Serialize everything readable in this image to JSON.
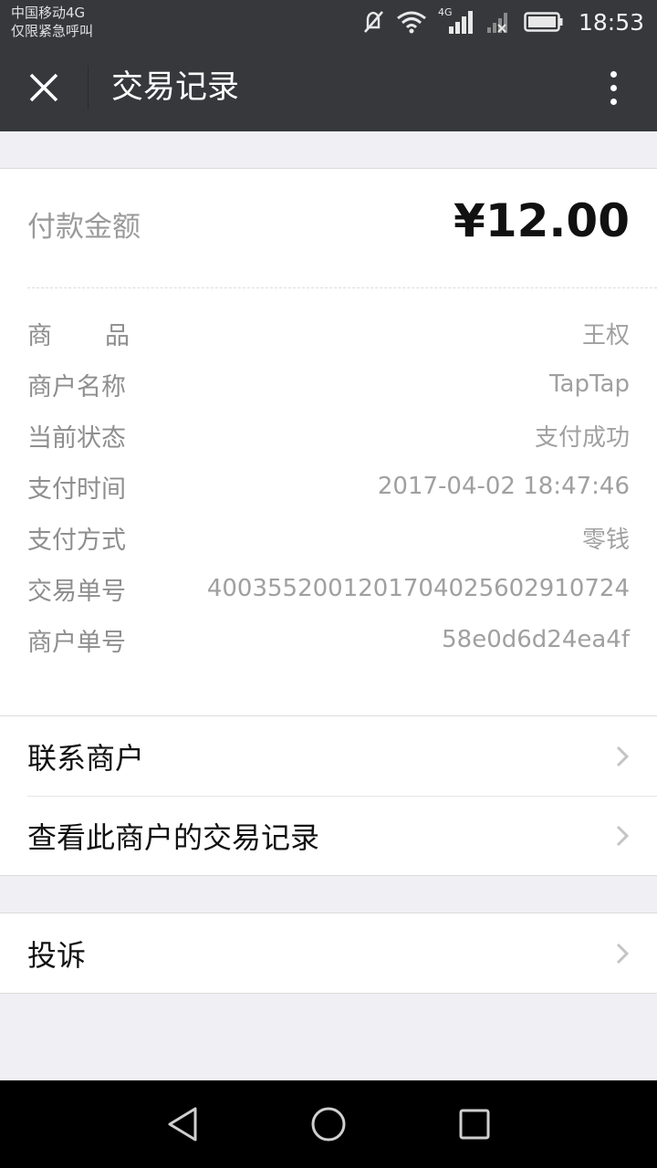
{
  "status_bar": {
    "carrier_line1": "中国移动4G",
    "carrier_line2": "仅限紧急呼叫",
    "network_label": "4G",
    "time": "18:53",
    "icons": [
      "mute-icon",
      "wifi-icon",
      "signal-icon",
      "no-signal-icon",
      "battery-icon"
    ]
  },
  "header": {
    "title": "交易记录",
    "close_icon": "close-icon",
    "more_icon": "more-vertical-icon"
  },
  "payment": {
    "amount_label": "付款金额",
    "amount_value": "¥12.00",
    "details": [
      {
        "label": "商品",
        "value": "王权"
      },
      {
        "label": "商户名称",
        "value": "TapTap"
      },
      {
        "label": "当前状态",
        "value": "支付成功"
      },
      {
        "label": "支付时间",
        "value": "2017-04-02 18:47:46"
      },
      {
        "label": "支付方式",
        "value": "零钱"
      },
      {
        "label": "交易单号",
        "value": "4003552001201704025602910724"
      },
      {
        "label": "商户单号",
        "value": "58e0d6d24ea4f"
      }
    ]
  },
  "actions": [
    {
      "label": "联系商户"
    },
    {
      "label": "查看此商户的交易记录"
    }
  ],
  "complaint": {
    "label": "投诉"
  },
  "nav_bar": {
    "icons": [
      "back-icon",
      "home-icon",
      "recents-icon"
    ]
  },
  "colors": {
    "bar_background": "#37383c",
    "page_background": "#efeff4"
  }
}
